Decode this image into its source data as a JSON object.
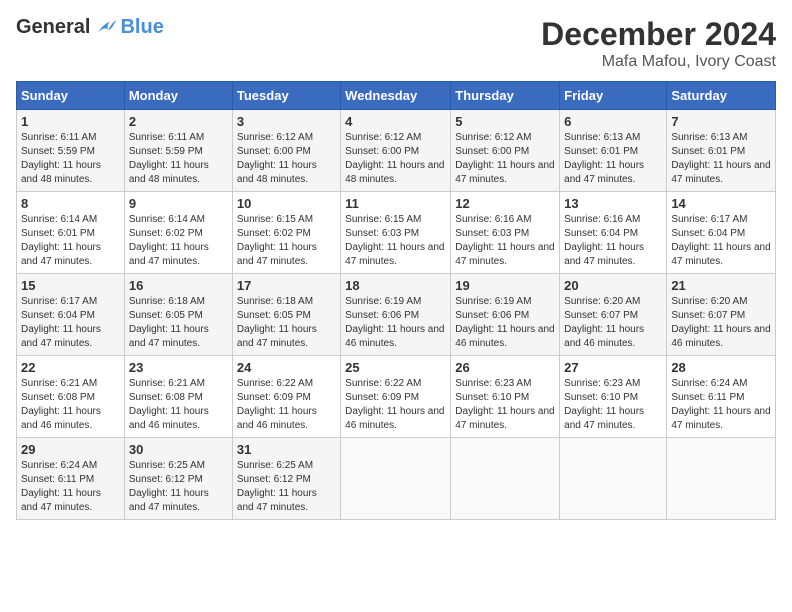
{
  "header": {
    "logo_general": "General",
    "logo_blue": "Blue",
    "title": "December 2024",
    "subtitle": "Mafa Mafou, Ivory Coast"
  },
  "weekdays": [
    "Sunday",
    "Monday",
    "Tuesday",
    "Wednesday",
    "Thursday",
    "Friday",
    "Saturday"
  ],
  "weeks": [
    [
      {
        "day": "1",
        "sunrise": "6:11 AM",
        "sunset": "5:59 PM",
        "daylight": "11 hours and 48 minutes."
      },
      {
        "day": "2",
        "sunrise": "6:11 AM",
        "sunset": "5:59 PM",
        "daylight": "11 hours and 48 minutes."
      },
      {
        "day": "3",
        "sunrise": "6:12 AM",
        "sunset": "6:00 PM",
        "daylight": "11 hours and 48 minutes."
      },
      {
        "day": "4",
        "sunrise": "6:12 AM",
        "sunset": "6:00 PM",
        "daylight": "11 hours and 48 minutes."
      },
      {
        "day": "5",
        "sunrise": "6:12 AM",
        "sunset": "6:00 PM",
        "daylight": "11 hours and 47 minutes."
      },
      {
        "day": "6",
        "sunrise": "6:13 AM",
        "sunset": "6:01 PM",
        "daylight": "11 hours and 47 minutes."
      },
      {
        "day": "7",
        "sunrise": "6:13 AM",
        "sunset": "6:01 PM",
        "daylight": "11 hours and 47 minutes."
      }
    ],
    [
      {
        "day": "8",
        "sunrise": "6:14 AM",
        "sunset": "6:01 PM",
        "daylight": "11 hours and 47 minutes."
      },
      {
        "day": "9",
        "sunrise": "6:14 AM",
        "sunset": "6:02 PM",
        "daylight": "11 hours and 47 minutes."
      },
      {
        "day": "10",
        "sunrise": "6:15 AM",
        "sunset": "6:02 PM",
        "daylight": "11 hours and 47 minutes."
      },
      {
        "day": "11",
        "sunrise": "6:15 AM",
        "sunset": "6:03 PM",
        "daylight": "11 hours and 47 minutes."
      },
      {
        "day": "12",
        "sunrise": "6:16 AM",
        "sunset": "6:03 PM",
        "daylight": "11 hours and 47 minutes."
      },
      {
        "day": "13",
        "sunrise": "6:16 AM",
        "sunset": "6:04 PM",
        "daylight": "11 hours and 47 minutes."
      },
      {
        "day": "14",
        "sunrise": "6:17 AM",
        "sunset": "6:04 PM",
        "daylight": "11 hours and 47 minutes."
      }
    ],
    [
      {
        "day": "15",
        "sunrise": "6:17 AM",
        "sunset": "6:04 PM",
        "daylight": "11 hours and 47 minutes."
      },
      {
        "day": "16",
        "sunrise": "6:18 AM",
        "sunset": "6:05 PM",
        "daylight": "11 hours and 47 minutes."
      },
      {
        "day": "17",
        "sunrise": "6:18 AM",
        "sunset": "6:05 PM",
        "daylight": "11 hours and 47 minutes."
      },
      {
        "day": "18",
        "sunrise": "6:19 AM",
        "sunset": "6:06 PM",
        "daylight": "11 hours and 46 minutes."
      },
      {
        "day": "19",
        "sunrise": "6:19 AM",
        "sunset": "6:06 PM",
        "daylight": "11 hours and 46 minutes."
      },
      {
        "day": "20",
        "sunrise": "6:20 AM",
        "sunset": "6:07 PM",
        "daylight": "11 hours and 46 minutes."
      },
      {
        "day": "21",
        "sunrise": "6:20 AM",
        "sunset": "6:07 PM",
        "daylight": "11 hours and 46 minutes."
      }
    ],
    [
      {
        "day": "22",
        "sunrise": "6:21 AM",
        "sunset": "6:08 PM",
        "daylight": "11 hours and 46 minutes."
      },
      {
        "day": "23",
        "sunrise": "6:21 AM",
        "sunset": "6:08 PM",
        "daylight": "11 hours and 46 minutes."
      },
      {
        "day": "24",
        "sunrise": "6:22 AM",
        "sunset": "6:09 PM",
        "daylight": "11 hours and 46 minutes."
      },
      {
        "day": "25",
        "sunrise": "6:22 AM",
        "sunset": "6:09 PM",
        "daylight": "11 hours and 46 minutes."
      },
      {
        "day": "26",
        "sunrise": "6:23 AM",
        "sunset": "6:10 PM",
        "daylight": "11 hours and 47 minutes."
      },
      {
        "day": "27",
        "sunrise": "6:23 AM",
        "sunset": "6:10 PM",
        "daylight": "11 hours and 47 minutes."
      },
      {
        "day": "28",
        "sunrise": "6:24 AM",
        "sunset": "6:11 PM",
        "daylight": "11 hours and 47 minutes."
      }
    ],
    [
      {
        "day": "29",
        "sunrise": "6:24 AM",
        "sunset": "6:11 PM",
        "daylight": "11 hours and 47 minutes."
      },
      {
        "day": "30",
        "sunrise": "6:25 AM",
        "sunset": "6:12 PM",
        "daylight": "11 hours and 47 minutes."
      },
      {
        "day": "31",
        "sunrise": "6:25 AM",
        "sunset": "6:12 PM",
        "daylight": "11 hours and 47 minutes."
      },
      null,
      null,
      null,
      null
    ]
  ]
}
